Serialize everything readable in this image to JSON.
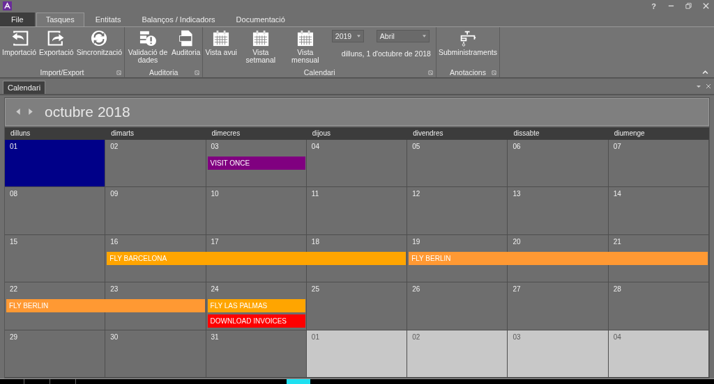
{
  "window": {
    "controls": [
      "?"
    ]
  },
  "menu_tabs": [
    {
      "label": "File",
      "kind": "file",
      "selected": false
    },
    {
      "label": "Tasques",
      "kind": "tab",
      "selected": true
    },
    {
      "label": "Entitats",
      "kind": "tab",
      "selected": false
    },
    {
      "label": "Balanços / Indicadors",
      "kind": "tab",
      "selected": false
    },
    {
      "label": "Documentació",
      "kind": "tab",
      "selected": false
    }
  ],
  "ribbon": {
    "groups": [
      {
        "label": "Import/Export",
        "items": [
          {
            "kind": "button",
            "label": "Importació"
          },
          {
            "kind": "button",
            "label": "Exportació"
          },
          {
            "kind": "button",
            "label": "Sincronització"
          }
        ]
      },
      {
        "label": "Auditoria",
        "items": [
          {
            "kind": "button",
            "label": "Validació de dades"
          },
          {
            "kind": "button",
            "label": "Auditoria"
          }
        ]
      },
      {
        "label": "Calendari",
        "items": [
          {
            "kind": "button",
            "label": "Vista avui"
          },
          {
            "kind": "button",
            "label": "Vista setmanal"
          },
          {
            "kind": "button",
            "label": "Vista mensual"
          },
          {
            "kind": "pickers",
            "year": "2019",
            "month": "Abril",
            "date": "dilluns, 1 d'octubre de 2018"
          }
        ]
      },
      {
        "label": "Anotacions",
        "items": [
          {
            "kind": "button",
            "label": "Subministraments"
          }
        ]
      }
    ]
  },
  "document_tab": {
    "label": "Calendari"
  },
  "calendar": {
    "title": "octubre 2018",
    "weekdays": [
      "dilluns",
      "dimarts",
      "dimecres",
      "dijous",
      "divendres",
      "dissabte",
      "diumenge"
    ],
    "weeks": [
      {
        "days": [
          {
            "label": "01",
            "selected": true,
            "other_month": false
          },
          {
            "label": "02",
            "selected": false,
            "other_month": false
          },
          {
            "label": "03",
            "selected": false,
            "other_month": false,
            "events": [
              {
                "kind": "event",
                "title": "VISIT ONCE",
                "color": "#800080"
              }
            ]
          },
          {
            "label": "04",
            "selected": false,
            "other_month": false
          },
          {
            "label": "05",
            "selected": false,
            "other_month": false
          },
          {
            "label": "06",
            "selected": false,
            "other_month": false
          },
          {
            "label": "07",
            "selected": false,
            "other_month": false
          }
        ]
      },
      {
        "days": [
          {
            "label": "08",
            "selected": false,
            "other_month": false
          },
          {
            "label": "09",
            "selected": false,
            "other_month": false
          },
          {
            "label": "10",
            "selected": false,
            "other_month": false
          },
          {
            "label": "11",
            "selected": false,
            "other_month": false
          },
          {
            "label": "12",
            "selected": false,
            "other_month": false
          },
          {
            "label": "13",
            "selected": false,
            "other_month": false
          },
          {
            "label": "14",
            "selected": false,
            "other_month": false
          }
        ]
      },
      {
        "days": [
          {
            "label": "15",
            "selected": false,
            "other_month": false
          },
          {
            "label": "16",
            "selected": false,
            "other_month": false,
            "events": [
              {
                "kind": "event",
                "title": "FLY BARCELONA",
                "color": "#ffa500"
              }
            ]
          },
          {
            "label": "17",
            "selected": false,
            "other_month": false,
            "events": [
              {
                "kind": "continuation"
              }
            ]
          },
          {
            "label": "18",
            "selected": false,
            "other_month": false,
            "events": [
              {
                "kind": "continuation"
              }
            ]
          },
          {
            "label": "19",
            "selected": false,
            "other_month": false,
            "events": [
              {
                "kind": "event",
                "title": "FLY BERLIN",
                "color": "#ff9933"
              }
            ]
          },
          {
            "label": "20",
            "selected": false,
            "other_month": false,
            "events": [
              {
                "kind": "continuation"
              }
            ]
          },
          {
            "label": "21",
            "selected": false,
            "other_month": false,
            "events": [
              {
                "kind": "continuation"
              }
            ]
          }
        ]
      },
      {
        "days": [
          {
            "label": "22",
            "selected": false,
            "other_month": false,
            "events": [
              {
                "kind": "event",
                "title": "FLY BERLIN",
                "color": "#ff9933"
              }
            ]
          },
          {
            "label": "23",
            "selected": false,
            "other_month": false,
            "events": [
              {
                "kind": "continuation"
              }
            ]
          },
          {
            "label": "24",
            "selected": false,
            "other_month": false,
            "events": [
              {
                "kind": "event",
                "title": "FLY LAS PALMAS",
                "color": "#ffa500"
              },
              {
                "kind": "event",
                "title": "DOWNLOAD INVOICES",
                "color": "#ff0000"
              }
            ]
          },
          {
            "label": "25",
            "selected": false,
            "other_month": false
          },
          {
            "label": "26",
            "selected": false,
            "other_month": false
          },
          {
            "label": "27",
            "selected": false,
            "other_month": false
          },
          {
            "label": "28",
            "selected": false,
            "other_month": false
          }
        ]
      },
      {
        "days": [
          {
            "label": "29",
            "selected": false,
            "other_month": false
          },
          {
            "label": "30",
            "selected": false,
            "other_month": false
          },
          {
            "label": "31",
            "selected": false,
            "other_month": false
          },
          {
            "label": "01",
            "selected": false,
            "other_month": true
          },
          {
            "label": "02",
            "selected": false,
            "other_month": true
          },
          {
            "label": "03",
            "selected": false,
            "other_month": true
          },
          {
            "label": "04",
            "selected": false,
            "other_month": true
          }
        ]
      }
    ]
  }
}
